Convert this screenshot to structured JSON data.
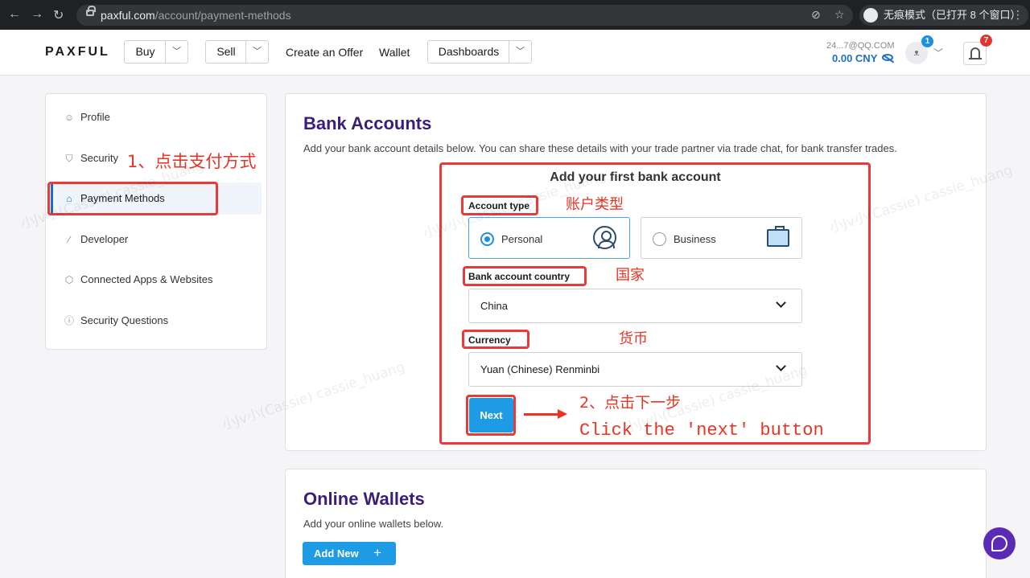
{
  "browser": {
    "url_host": "paxful.com",
    "url_path": "/account/payment-methods",
    "incognito_label": "无痕模式（已打开 8 个窗口）"
  },
  "header": {
    "logo": "PAXFUL",
    "buy_label": "Buy",
    "sell_label": "Sell",
    "create_offer_label": "Create an Offer",
    "wallet_label": "Wallet",
    "dashboards_label": "Dashboards",
    "account_email": "24...7@QQ.COM",
    "balance": "0.00 CNY",
    "profile_badge": "1",
    "notifications_badge": "7"
  },
  "sidebar": {
    "items": [
      {
        "label": "Profile",
        "icon": "person-icon"
      },
      {
        "label": "Security",
        "icon": "shield-icon"
      },
      {
        "label": "Payment Methods",
        "icon": "bank-icon",
        "active": true
      },
      {
        "label": "Developer",
        "icon": "code-icon"
      },
      {
        "label": "Connected Apps & Websites",
        "icon": "cube-icon"
      },
      {
        "label": "Security Questions",
        "icon": "info-icon"
      }
    ]
  },
  "bank": {
    "title": "Bank Accounts",
    "description": "Add your bank account details below. You can share these details with your trade partner via trade chat, for bank transfer trades.",
    "form_title": "Add your first bank account",
    "account_type_label": "Account type",
    "personal_label": "Personal",
    "business_label": "Business",
    "selected_type": "Personal",
    "country_label": "Bank account country",
    "country_value": "China",
    "currency_label": "Currency",
    "currency_value": "Yuan (Chinese) Renminbi",
    "next_label": "Next"
  },
  "wallets": {
    "title": "Online Wallets",
    "description": "Add your online wallets below.",
    "add_label": "Add New",
    "add_icon": "+"
  },
  "annotations": {
    "step1": "1、点击支付方式",
    "account_type_cn": "账户类型",
    "country_cn": "国家",
    "currency_cn": "货币",
    "step2": "2、点击下一步",
    "step2_en": "Click the 'next' button"
  },
  "watermark": "小Jv小(Cassie) cassie_huang",
  "colors": {
    "brand_purple": "#3b1d7a",
    "primary_blue": "#1d9be4",
    "annotation_red": "#ea3323"
  }
}
